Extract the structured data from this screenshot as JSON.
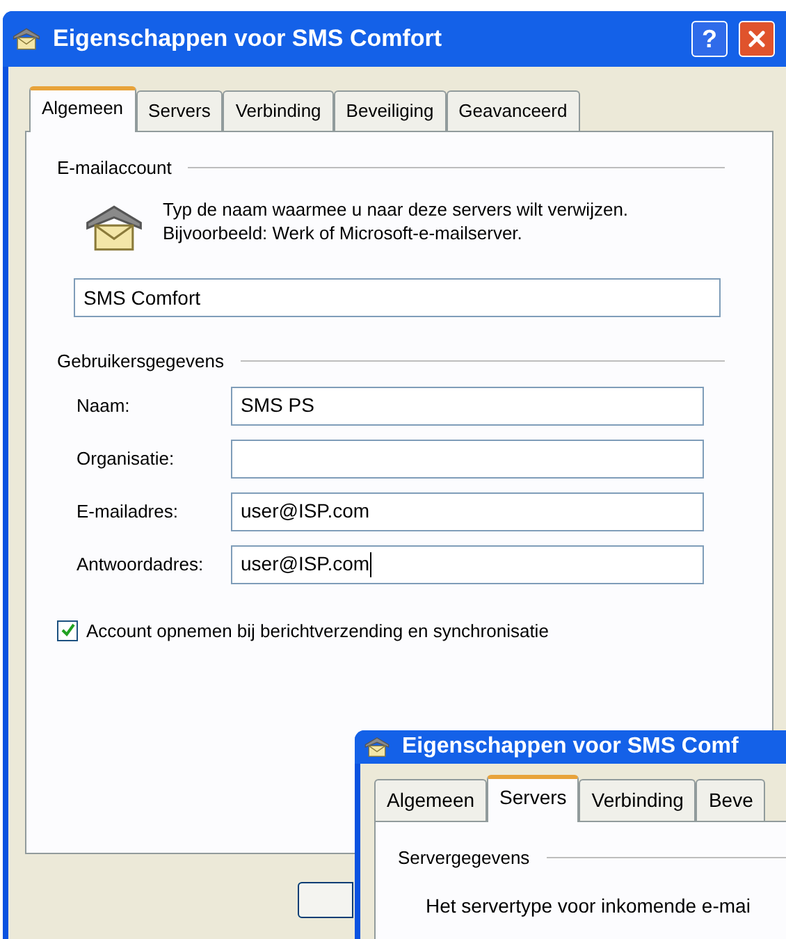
{
  "window": {
    "title": "Eigenschappen voor SMS Comfort",
    "help_label": "?"
  },
  "tabs": [
    {
      "label": "Algemeen",
      "selected": true
    },
    {
      "label": "Servers",
      "selected": false
    },
    {
      "label": "Verbinding",
      "selected": false
    },
    {
      "label": "Beveiliging",
      "selected": false
    },
    {
      "label": "Geavanceerd",
      "selected": false
    }
  ],
  "email_account": {
    "heading": "E-mailaccount",
    "description": "Typ de naam waarmee u naar deze servers wilt verwijzen. Bijvoorbeeld: Werk of Microsoft-e-mailserver.",
    "account_name": "SMS Comfort"
  },
  "user_info": {
    "heading": "Gebruikersgegevens",
    "fields": [
      {
        "label": "Naam:",
        "value": "SMS PS",
        "focused": false
      },
      {
        "label": "Organisatie:",
        "focused": false
      },
      {
        "label": "E-mailadres:",
        "value": "user@ISP.com",
        "focused": false
      },
      {
        "label": "Antwoordadres:",
        "value": "user@ISP.com",
        "focused": true
      }
    ]
  },
  "include_account": {
    "label": "Account opnemen bij berichtverzending en synchronisatie",
    "checked": true
  },
  "second_window": {
    "title": "Eigenschappen voor SMS Comf",
    "tabs": [
      {
        "label": "Algemeen",
        "selected": false
      },
      {
        "label": "Servers",
        "selected": true
      },
      {
        "label": "Verbinding",
        "selected": false
      },
      {
        "label": "Beve",
        "selected": false
      }
    ],
    "section_heading": "Servergegevens",
    "text": "Het servertype voor inkomende e-mai"
  }
}
